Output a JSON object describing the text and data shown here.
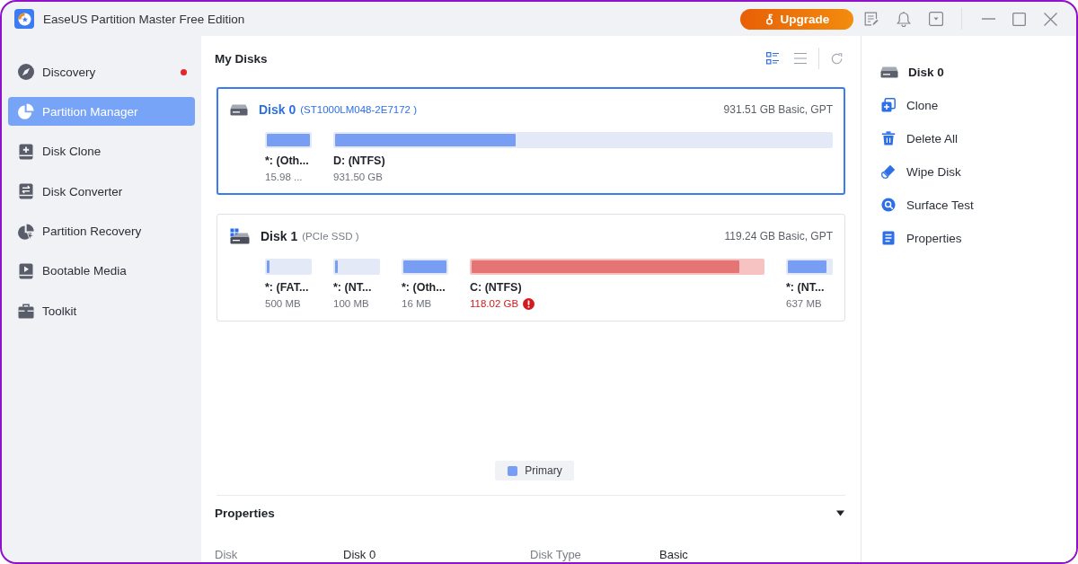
{
  "window": {
    "title": "EaseUS Partition Master Free Edition"
  },
  "title_bar": {
    "upgrade": "Upgrade"
  },
  "sidebar": {
    "items": [
      {
        "label": "Discovery",
        "selected": false,
        "dot": true
      },
      {
        "label": "Partition Manager",
        "selected": true,
        "dot": false
      },
      {
        "label": "Disk Clone",
        "selected": false,
        "dot": false
      },
      {
        "label": "Disk Converter",
        "selected": false,
        "dot": false
      },
      {
        "label": "Partition Recovery",
        "selected": false,
        "dot": false
      },
      {
        "label": "Bootable Media",
        "selected": false,
        "dot": false
      },
      {
        "label": "Toolkit",
        "selected": false,
        "dot": false
      }
    ]
  },
  "disks_panel": {
    "title": "My Disks",
    "view_modes": [
      {
        "kind": "cards",
        "selected": true
      },
      {
        "kind": "list",
        "selected": false
      }
    ],
    "disks": [
      {
        "kind": "hdd",
        "name": "Disk 0",
        "model": "(ST1000LM048-2E7172 )",
        "summary": "931.51 GB Basic, GPT",
        "selected": true,
        "partitions": [
          {
            "kind": "small",
            "label": "*: (Oth...",
            "size": "15.98 ...",
            "level": 1,
            "color": "#779ef2",
            "warning": false
          },
          {
            "kind": "large",
            "label": "D: (NTFS)",
            "size": "931.50 GB",
            "level": 0.365,
            "color": "#779ef2",
            "warning": false
          }
        ]
      },
      {
        "kind": "ssd",
        "name": "Disk 1",
        "model": "(PCIe SSD )",
        "summary": "119.24 GB Basic, GPT",
        "selected": false,
        "partitions": [
          {
            "kind": "small",
            "label": "*: (FAT...",
            "size": "500 MB",
            "level": 0.07,
            "color": "#779ef2",
            "warning": false
          },
          {
            "kind": "small",
            "label": "*: (NT...",
            "size": "100 MB",
            "level": 0.07,
            "color": "#779ef2",
            "warning": false
          },
          {
            "kind": "small",
            "label": "*: (Oth...",
            "size": "16 MB",
            "level": 1,
            "color": "#779ef2",
            "warning": false
          },
          {
            "kind": "large",
            "label": "C: (NTFS)",
            "size": "118.02 GB",
            "level": 0.92,
            "color": "#e57575",
            "warning": true
          },
          {
            "kind": "small",
            "label": "*: (NT...",
            "size": "637 MB",
            "level": 0.9,
            "color": "#779ef2",
            "warning": false
          }
        ]
      }
    ]
  },
  "legend": [
    {
      "label": "Primary",
      "color": "#779ef2"
    }
  ],
  "properties": {
    "title": "Properties",
    "expanded": true,
    "fields": [
      {
        "label": "Disk",
        "value": "Disk 0"
      },
      {
        "label": "Disk Type",
        "value": "Basic"
      }
    ]
  },
  "actions_panel": {
    "disk": "Disk 0",
    "actions": [
      "Clone",
      "Delete All",
      "Wipe Disk",
      "Surface Test",
      "Properties"
    ]
  }
}
